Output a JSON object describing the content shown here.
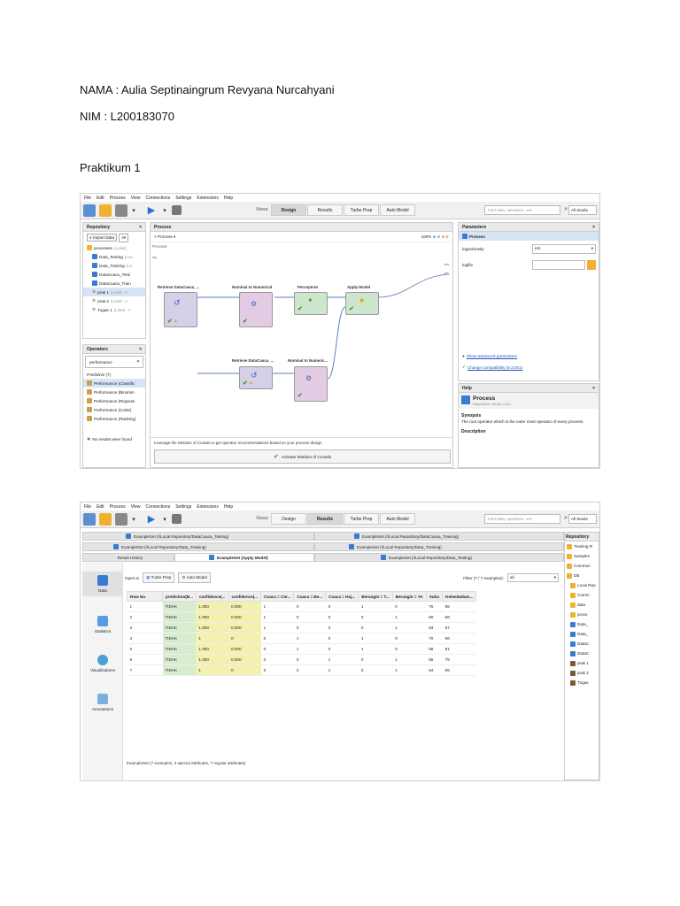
{
  "doc": {
    "name_line": "NAMA : Aulia Septinaingrum Revyana Nurcahyani",
    "nim_line": "NIM : L200183070",
    "heading": "Praktikum 1"
  },
  "menu": [
    "File",
    "Edit",
    "Process",
    "View",
    "Connections",
    "Settings",
    "Extensions",
    "Help"
  ],
  "toolbar": {
    "views_label": "Views:",
    "tabs": [
      "Design",
      "Results",
      "Turbo Prep",
      "Auto Model"
    ],
    "search_placeholder": "Find data, operators...etc",
    "studio_label": "All Studio"
  },
  "shot1": {
    "repository": {
      "title": "Repository",
      "import_label": "Import Data",
      "items": [
        {
          "label": "processes",
          "meta": "(Lokal)"
        },
        {
          "label": "Data_Testing",
          "meta": "(Loc"
        },
        {
          "label": "Data_Training",
          "meta": "(Lo"
        },
        {
          "label": "DataCuaca_Testi",
          "meta": ""
        },
        {
          "label": "DataCuaca_Train",
          "meta": ""
        },
        {
          "label": "prak 1",
          "meta": "(Lokal - v"
        },
        {
          "label": "prak 2",
          "meta": "(Lokal - v"
        },
        {
          "label": "Tugas 1",
          "meta": "(Lokal - v"
        }
      ]
    },
    "operators": {
      "title": "Operators",
      "search_value": "performance",
      "group": "Predictive (7)",
      "items": [
        "Performance (Classific",
        "Performance (Binomin",
        "Performance (Regress",
        "Performance (Costs)",
        "Performance (Ranking)"
      ],
      "no_results": "No results were found"
    },
    "process": {
      "tab": "Process",
      "crumb": "Process",
      "zoom": "100%",
      "canvas_label": "Process",
      "port_inp": "inp",
      "port_res": "res",
      "ops": {
        "retrieve1": "Retrieve DataCuaca_...",
        "n2n1": "Nominal to Numerical",
        "perceptron": "Perceptron",
        "apply": "Apply Model",
        "retrieve2": "Retrieve DataCuaca_...",
        "n2n2": "Nominal to Numeric..."
      },
      "leverage": "Leverage the Wisdom of Crowds to get operator recommendations based on your process design",
      "activate": "Activate Wisdom of Crowds"
    },
    "parameters": {
      "title": "Parameters",
      "process_label": "Process",
      "rows": [
        {
          "label": "logverbosity",
          "value": "init"
        },
        {
          "label": "logfile",
          "value": ""
        }
      ],
      "advanced_link": "Show advanced parameters",
      "compat_link": "Change compatibility (9.3.001)"
    },
    "help": {
      "title": "Help",
      "op_name": "Process",
      "op_sub": "RapidMiner Studio Core",
      "synopsis_h": "Synopsis",
      "synopsis": "The root operator which is the outer most operator of every process.",
      "description_h": "Description"
    }
  },
  "shot2": {
    "doc_tabs_row1": [
      "ExampleSet (//Local Repository/DataCuaca_Testing)",
      "ExampleSet (//Local Repository/DataCuaca_Training)"
    ],
    "doc_tabs_row2": [
      "ExampleSet (//Local Repository/Data_Training)",
      "ExampleSet (//Local Repository/Data_Training)"
    ],
    "doc_tabs_row3": [
      "Result History",
      "ExampleSet (Apply Model)",
      "ExampleSet (//Local Repository/Data_Testing)"
    ],
    "side": [
      "Data",
      "Statistics",
      "Visualizations",
      "Annotations"
    ],
    "open_in": "Open in",
    "turbo_prep": "Turbo Prep",
    "auto_model": "Auto Model",
    "filter_label": "Filter (7 / 7 examples):",
    "filter_value": "all",
    "columns": [
      "Row No.",
      "prediction(B...",
      "confidence(...",
      "confidence(...",
      "Cuaca = Cer...",
      "Cuaca = Be...",
      "Cuaca = Huj...",
      "Berangin = T...",
      "Berangin = YA",
      "Suhu",
      "Kelembaban..."
    ],
    "rows": [
      [
        "1",
        "TIDAK",
        "1.000",
        "0.000",
        "1",
        "0",
        "0",
        "1",
        "0",
        "75",
        "85"
      ],
      [
        "2",
        "TIDAK",
        "1.000",
        "0.000",
        "1",
        "0",
        "0",
        "0",
        "1",
        "80",
        "68"
      ],
      [
        "3",
        "TIDAK",
        "1.000",
        "0.000",
        "1",
        "0",
        "0",
        "0",
        "1",
        "83",
        "87"
      ],
      [
        "4",
        "TIDAK",
        "1",
        "0",
        "0",
        "1",
        "0",
        "1",
        "0",
        "70",
        "96"
      ],
      [
        "5",
        "TIDAK",
        "1.000",
        "0.000",
        "0",
        "1",
        "0",
        "1",
        "0",
        "68",
        "81"
      ],
      [
        "6",
        "TIDAK",
        "1.000",
        "0.000",
        "0",
        "0",
        "1",
        "0",
        "1",
        "65",
        "75"
      ],
      [
        "7",
        "TIDAK",
        "1",
        "0",
        "0",
        "0",
        "1",
        "0",
        "1",
        "64",
        "65"
      ]
    ],
    "footer": "ExampleSet (7 examples, 3 special attributes, 7 regular attributes)",
    "repo_title": "Repository",
    "repo_items": [
      "Training R",
      "Samples",
      "Commun",
      "DB",
      "Local Rep",
      "Comm",
      "data",
      "proce",
      "Data_",
      "Data_",
      "DataC",
      "DataC",
      "prak 1",
      "prak 2",
      "Tugas"
    ]
  }
}
